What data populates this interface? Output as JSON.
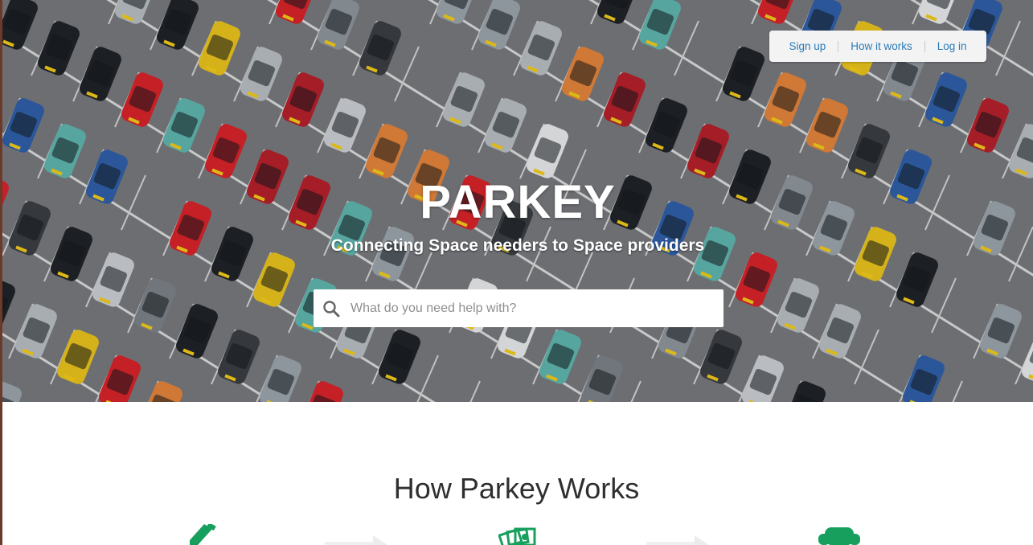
{
  "nav": {
    "links": [
      {
        "label": "Sign up"
      },
      {
        "label": "How it works"
      },
      {
        "label": "Log in"
      }
    ]
  },
  "hero": {
    "title": "PARKEY",
    "subtitle": "Connecting Space needers to Space providers",
    "background_image": "aerial view of cars in a parking lot"
  },
  "search": {
    "placeholder": "What do you need help with?",
    "value": ""
  },
  "how_it_works": {
    "title": "How Parkey Works",
    "steps": [
      {
        "icon": "pencil-icon"
      },
      {
        "icon": "cash-icon"
      },
      {
        "icon": "armchair-icon"
      }
    ]
  },
  "colors": {
    "accent_green": "#17a05d",
    "link_blue": "#2a7bb6",
    "heading_gray": "#2f2f2f"
  }
}
